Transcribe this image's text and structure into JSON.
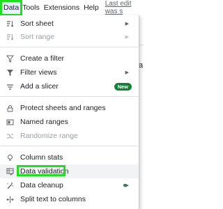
{
  "menubar": {
    "items": [
      {
        "label": "Data",
        "active": true
      },
      {
        "label": "Tools"
      },
      {
        "label": "Extensions"
      },
      {
        "label": "Help"
      }
    ],
    "last_edit": "Last edit was s"
  },
  "background": {
    "partial_letter": "a"
  },
  "menu": {
    "items": [
      {
        "label": "Sort sheet",
        "icon": "sort-icon",
        "disabled": false,
        "submenu": true
      },
      {
        "label": "Sort range",
        "icon": "sort-icon",
        "disabled": true,
        "submenu": true
      },
      {
        "label": "Create a filter",
        "icon": "filter-icon",
        "disabled": false
      },
      {
        "label": "Filter views",
        "icon": "filter-views-icon",
        "disabled": false,
        "submenu": true
      },
      {
        "label": "Add a slicer",
        "icon": "slicer-icon",
        "disabled": false,
        "badge": "New"
      },
      {
        "label": "Protect sheets and ranges",
        "icon": "lock-icon",
        "disabled": false
      },
      {
        "label": "Named ranges",
        "icon": "named-ranges-icon",
        "disabled": false
      },
      {
        "label": "Randomize range",
        "icon": "randomize-icon",
        "disabled": true
      },
      {
        "label": "Column stats",
        "icon": "lightbulb-icon",
        "disabled": false
      },
      {
        "label": "Data validation",
        "icon": "data-validation-icon",
        "disabled": false,
        "highlighted": true
      },
      {
        "label": "Data cleanup",
        "icon": "magic-wand-icon",
        "disabled": false,
        "submenu": true,
        "status_dot": true
      },
      {
        "label": "Split text to columns",
        "icon": "split-icon",
        "disabled": false
      }
    ]
  },
  "colors": {
    "highlight_outline": "#22dd22",
    "badge_green": "#188038",
    "dot_green": "#1e8e3e"
  }
}
